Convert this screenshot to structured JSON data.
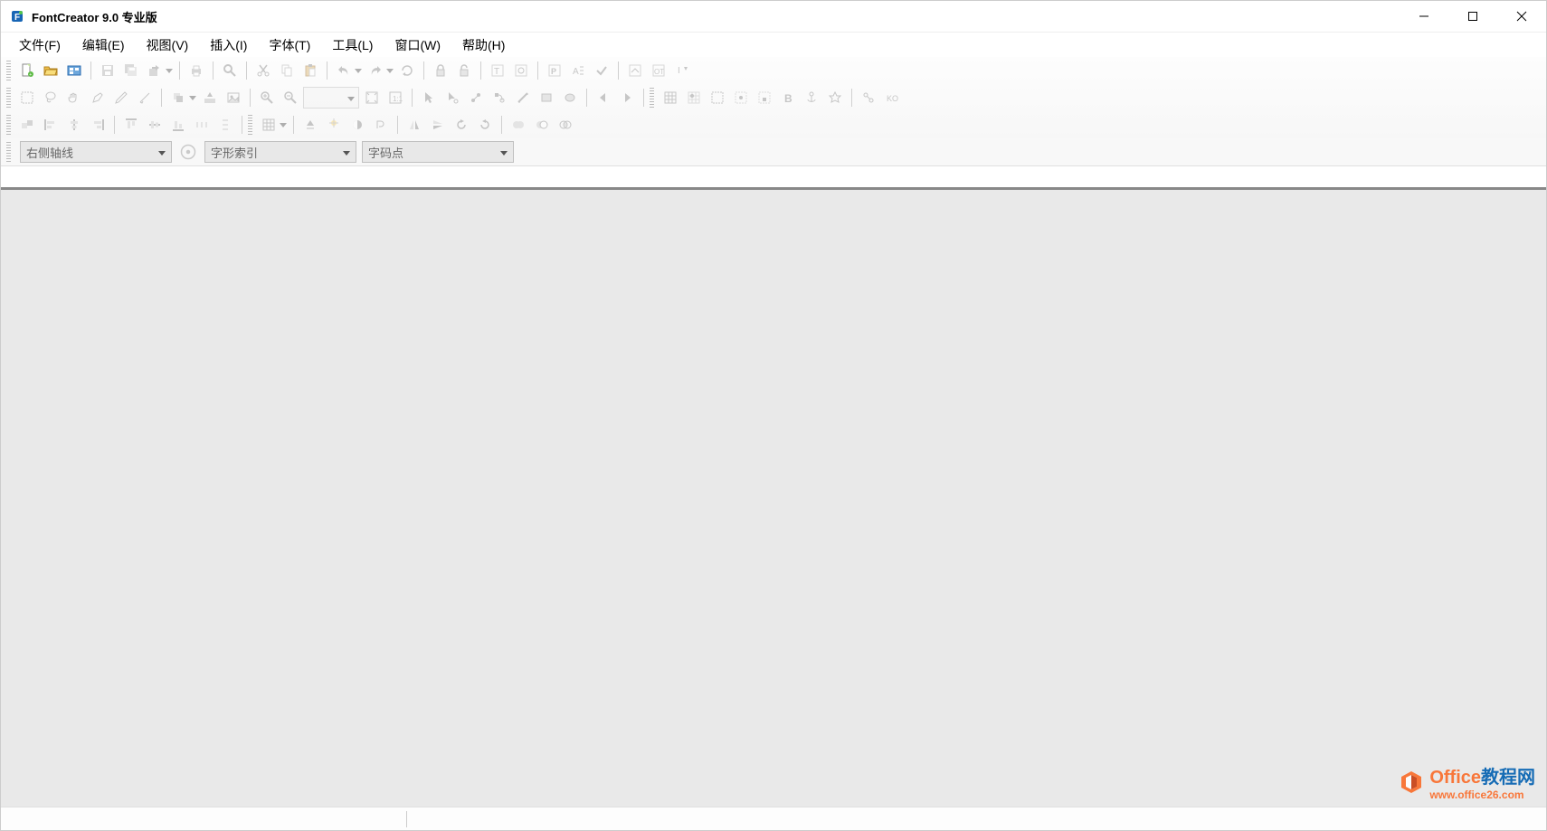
{
  "window": {
    "title": "FontCreator 9.0 专业版"
  },
  "menu": {
    "items": [
      "文件(F)",
      "编辑(E)",
      "视图(V)",
      "插入(I)",
      "字体(T)",
      "工具(L)",
      "窗口(W)",
      "帮助(H)"
    ]
  },
  "selectors": {
    "axis": "右侧轴线",
    "glyph_index": "字形索引",
    "codepoint": "字码点"
  },
  "watermark": {
    "brand1": "Office",
    "brand2": "教程网",
    "url": "www.office26.com"
  },
  "icons": {
    "new": "new-file-icon",
    "open": "open-folder-icon",
    "project": "project-icon",
    "save": "save-icon",
    "saveall": "save-all-icon",
    "paste_special": "paste-special-icon",
    "print": "print-icon",
    "find": "find-icon",
    "cut": "cut-icon",
    "copy": "copy-icon",
    "paste": "paste-icon",
    "undo": "undo-icon",
    "redo": "redo-icon",
    "repeat": "repeat-icon",
    "lock": "lock-icon",
    "unlock": "unlock-icon",
    "text": "text-tool-icon",
    "preview": "preview-icon",
    "paragraph": "paragraph-icon",
    "autometric": "autometric-icon",
    "check": "check-icon",
    "settings": "settings-icon",
    "opentype": "opentype-icon",
    "install": "install-icon",
    "select_rect": "select-rect-icon",
    "lasso": "lasso-icon",
    "hand": "hand-icon",
    "pen": "pen-icon",
    "pencil": "pencil-icon",
    "knife": "knife-icon",
    "layers": "layers-icon",
    "image": "image-icon",
    "color": "color-icon",
    "zoomin": "zoom-in-icon",
    "zoomout": "zoom-out-icon",
    "fit": "fit-icon",
    "actual": "actual-icon",
    "pointer": "pointer-icon",
    "pointer_add": "pointer-add-icon",
    "node_convert": "node-convert-icon",
    "node_smooth": "node-smooth-icon",
    "brush": "brush-icon",
    "rect": "rect-icon",
    "ellipse": "ellipse-icon",
    "prev": "prev-icon",
    "next": "next-icon",
    "grid": "grid-icon",
    "grid_snap": "grid-snap-icon",
    "guide": "guide-icon",
    "guide_snap": "guide-snap-icon",
    "guide_lock": "guide-lock-icon",
    "bold": "bold-icon",
    "anchor": "anchor-icon",
    "star": "star-icon",
    "link": "link-icon",
    "unlink": "unlink-icon",
    "align_left": "align-left-icon",
    "align_hcenter": "align-hcenter-icon",
    "align_right": "align-right-icon",
    "align_top": "align-top-icon",
    "align_vcenter": "align-vcenter-icon",
    "align_bottom": "align-bottom-icon",
    "dist_h": "distribute-h-icon",
    "dist_v": "distribute-v-icon",
    "flip_h": "flip-h-icon",
    "flip_v": "flip-v-icon",
    "rotate_cw": "rotate-cw-icon",
    "rotate_ccw": "rotate-ccw-icon",
    "order": "order-icon",
    "script": "script-icon",
    "contour": "contour-icon",
    "union": "union-icon",
    "subtract": "subtract-icon",
    "intersect": "intersect-icon",
    "table": "table-icon",
    "kerning": "kerning-icon",
    "metrics": "metrics-icon",
    "validate": "validate-icon"
  }
}
